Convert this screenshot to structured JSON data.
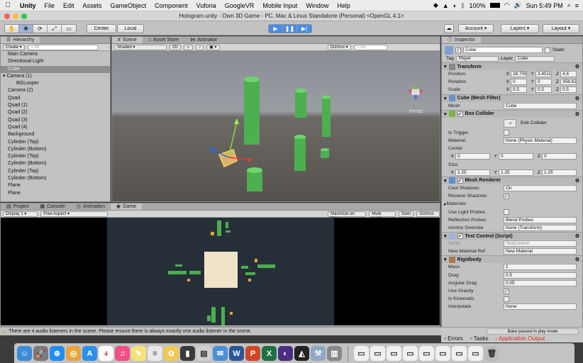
{
  "menubar": {
    "apple": "",
    "items": [
      "Unity",
      "File",
      "Edit",
      "Assets",
      "GameObject",
      "Component",
      "Vuforia",
      "GoogleVR",
      "Mobile Input",
      "Window",
      "Help"
    ],
    "battery": "100%",
    "clock": "Sun 5:49 PM"
  },
  "window": {
    "title": "Hologram.unity - Own 3D Game - PC, Mac & Linux Standalone (Personal) <OpenGL 4.1>"
  },
  "toolbar": {
    "transform_tools": [
      "✋",
      "✥",
      "⟳",
      "⤢",
      "▭"
    ],
    "pivot": "Center",
    "space": "Local",
    "account": "Account",
    "layers": "Layers",
    "layout": "Layout"
  },
  "hierarchy": {
    "tab": "Hierarchy",
    "create": "Create",
    "search_placeholder": "All",
    "items": [
      {
        "label": "Main Camera"
      },
      {
        "label": "Directional Light"
      },
      {
        "label": "Cube",
        "selected": true
      },
      {
        "label": "Camera (1)",
        "expandable": true
      },
      {
        "label": "BGLooper",
        "child": true
      },
      {
        "label": "Camera (2)"
      },
      {
        "label": "Quad"
      },
      {
        "label": "Quad (1)"
      },
      {
        "label": "Quad (2)"
      },
      {
        "label": "Quad (3)"
      },
      {
        "label": "Quad (4)"
      },
      {
        "label": "Background"
      },
      {
        "label": "Cylinder (Top)"
      },
      {
        "label": "Cylinder (Bottom)"
      },
      {
        "label": "Cylinder (Top)"
      },
      {
        "label": "Cylinder (Bottom)"
      },
      {
        "label": "Cylinder (Top)"
      },
      {
        "label": "Cylinder (Bottom)"
      },
      {
        "label": "Plane"
      },
      {
        "label": "Plane"
      }
    ]
  },
  "scene": {
    "tabs": [
      "Scene",
      "Asset Store",
      "Animator"
    ],
    "shading": "Shaded",
    "mode2d": "2D",
    "gizmos": "Gizmos",
    "search_placeholder": "All",
    "persp": "Persp"
  },
  "bottom": {
    "tabs": [
      "Project",
      "Console",
      "Animation",
      "Game"
    ],
    "display": "Display 1",
    "aspect": "Free Aspect",
    "options": [
      "Maximize on Play",
      "Mute audio",
      "Stats",
      "Gizmos"
    ]
  },
  "inspector": {
    "tab": "Inspector",
    "object_name": "Cube",
    "static": "Static",
    "tag_label": "Tag",
    "tag": "Player",
    "layer_label": "Layer",
    "layer": "Cube",
    "transform": {
      "title": "Transform",
      "position": {
        "label": "Position",
        "x": "28.706",
        "y": "3.4511",
        "z": "4.6"
      },
      "rotation": {
        "label": "Rotation",
        "x": "0",
        "y": "0",
        "z": "358.62"
      },
      "scale": {
        "label": "Scale",
        "x": "0.5",
        "y": "0.5",
        "z": "0.5"
      }
    },
    "mesh_filter": {
      "title": "Cube (Mesh Filter)",
      "mesh_label": "Mesh",
      "mesh": "Cube"
    },
    "box_collider": {
      "title": "Box Collider",
      "edit": "Edit Collider",
      "trigger_label": "Is Trigger",
      "material_label": "Material",
      "material": "None (Physic Material)",
      "center_label": "Center",
      "center": {
        "x": "0",
        "y": "0",
        "z": "0"
      },
      "size_label": "Size",
      "size": {
        "x": "1.25",
        "y": "1.25",
        "z": "1.25"
      }
    },
    "mesh_renderer": {
      "title": "Mesh Renderer",
      "cast_label": "Cast Shadows",
      "cast": "On",
      "receive_label": "Receive Shadows",
      "materials_label": "Materials",
      "light_probes_label": "Use Light Probes",
      "reflection_label": "Reflection Probes",
      "reflection": "Blend Probes",
      "anchor_label": "Anchor Override",
      "anchor": "None (Transform)"
    },
    "test_control": {
      "title": "Test Control (Script)",
      "script_label": "Script",
      "script": "TestControl",
      "ref_label": "New Material Ref",
      "ref": "New Material"
    },
    "rigidbody": {
      "title": "Rigidbody",
      "mass_label": "Mass",
      "mass": "1",
      "drag_label": "Drag",
      "drag": "0.5",
      "angular_label": "Angular Drag",
      "angular": "0.05",
      "gravity_label": "Use Gravity",
      "kinematic_label": "Is Kinematic",
      "interpolate_label": "Interpolate",
      "interpolate": "None"
    },
    "footer_tabs": [
      "Errors",
      "Tasks",
      "Application Output"
    ],
    "bake_notice": "Bake paused in play mode"
  },
  "status": {
    "message": "There are 4 audio listeners in the scene. Please ensure there is always exactly one audio listener in the scene."
  },
  "dock": {
    "date": "4"
  },
  "colors": {
    "selection": "#4a8be8",
    "cylinder": "#4caf50",
    "status_warn": "#e6b800",
    "error": "#d62d20"
  }
}
